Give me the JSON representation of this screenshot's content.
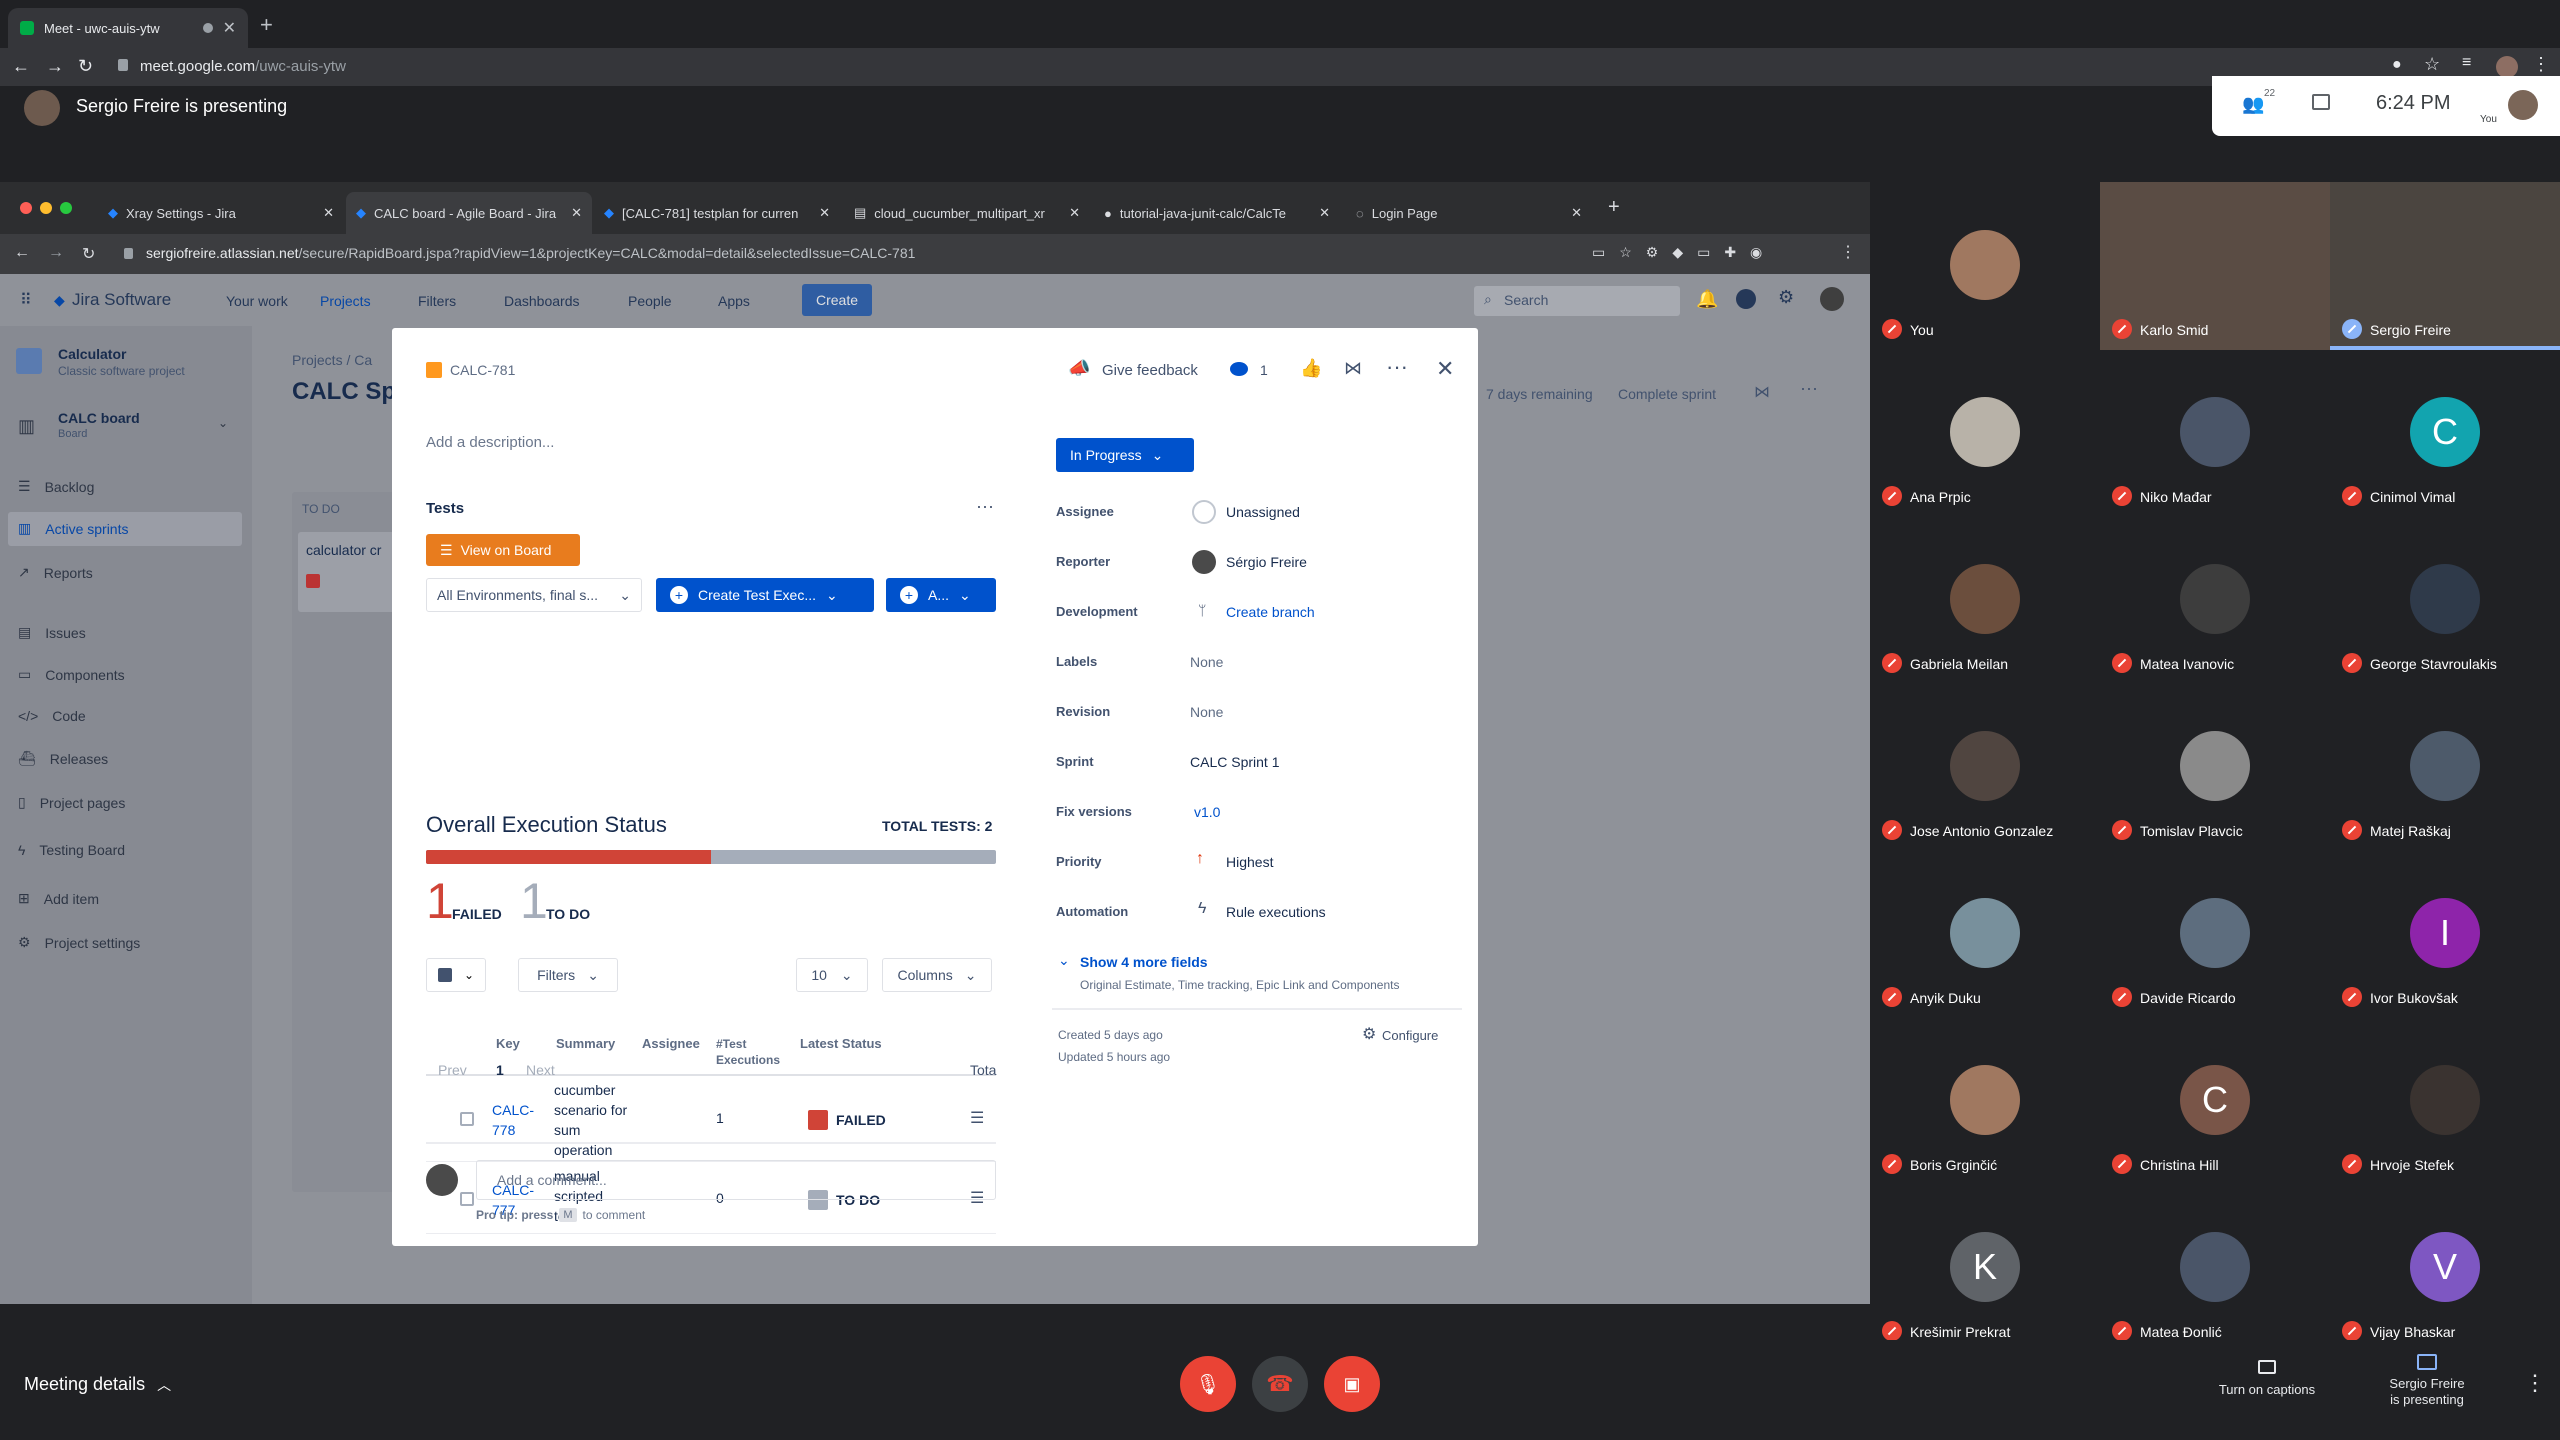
{
  "outer_tab": {
    "title": "Meet - uwc-auis-ytw"
  },
  "outer_url": {
    "domain": "meet.google.com",
    "path": "/uwc-auis-ytw"
  },
  "meet_top": {
    "presenting": "Sergio Freire is presenting",
    "participants_count": "22",
    "time": "6:24 PM",
    "you": "You"
  },
  "inner_tabs": [
    {
      "title": "Xray Settings - Jira"
    },
    {
      "title": "CALC board - Agile Board - Jira"
    },
    {
      "title": "[CALC-781] testplan for curren"
    },
    {
      "title": "cloud_cucumber_multipart_xr"
    },
    {
      "title": "tutorial-java-junit-calc/CalcTe"
    },
    {
      "title": "Login Page"
    }
  ],
  "inner_url": {
    "domain": "sergiofreire.atlassian.net",
    "path": "/secure/RapidBoard.jspa?rapidView=1&projectKey=CALC&modal=detail&selectedIssue=CALC-781"
  },
  "jira_nav": {
    "logo": "Jira Software",
    "your_work": "Your work",
    "projects": "Projects",
    "filters": "Filters",
    "dashboards": "Dashboards",
    "people": "People",
    "apps": "Apps",
    "create": "Create",
    "search_placeholder": "Search"
  },
  "sidebar": {
    "project_name": "Calculator",
    "project_type": "Classic software project",
    "board_name": "CALC board",
    "board_sub": "Board",
    "items": [
      {
        "label": "Backlog"
      },
      {
        "label": "Active sprints"
      },
      {
        "label": "Reports"
      },
      {
        "label": "Issues"
      },
      {
        "label": "Components"
      },
      {
        "label": "Code"
      },
      {
        "label": "Releases"
      },
      {
        "label": "Project pages"
      },
      {
        "label": "Testing Board"
      },
      {
        "label": "Add item"
      },
      {
        "label": "Project settings"
      }
    ]
  },
  "board": {
    "breadcrumb": "Projects  /  Ca",
    "title": "CALC Spr",
    "days_remaining": "7 days remaining",
    "complete_sprint": "Complete sprint",
    "col_todo": "TO DO",
    "card": "calculator cr"
  },
  "modal": {
    "issue_key": "CALC-781",
    "give_feedback": "Give feedback",
    "watchers": "1",
    "add_description": "Add a description...",
    "tests_heading": "Tests",
    "view_on_board": "View on Board",
    "env_select": "All Environments, final s...",
    "create_test_exec": "Create Test Exec...",
    "a_button": "A...",
    "overall_status": "Overall Execution Status",
    "total_tests": "TOTAL TESTS: 2",
    "failed_count": "1",
    "failed_label": "FAILED",
    "todo_count": "1",
    "todo_label": "TO DO",
    "filters": "Filters",
    "page_size": "10",
    "columns": "Columns",
    "table": {
      "headers": {
        "key": "Key",
        "summary": "Summary",
        "assignee": "Assignee",
        "executions": "#Test Executions",
        "status": "Latest Status"
      },
      "rows": [
        {
          "key": "CALC-778",
          "summary": "cucumber scenario for sum operation",
          "executions": "1",
          "status": "FAILED"
        },
        {
          "key": "CALC-777",
          "summary": "manual scripted test",
          "executions": "0",
          "status": "TO DO"
        }
      ]
    },
    "pager": {
      "prev": "Prev",
      "page": "1",
      "next": "Next",
      "total": "Tota"
    },
    "comment_placeholder": "Add a comment...",
    "pro_tip_prefix": "Pro tip: press",
    "pro_tip_key": "M",
    "pro_tip_suffix": "to comment",
    "status_button": "In Progress",
    "fields": {
      "assignee_label": "Assignee",
      "assignee": "Unassigned",
      "reporter_label": "Reporter",
      "reporter": "Sérgio Freire",
      "development_label": "Development",
      "development": "Create branch",
      "labels_label": "Labels",
      "labels": "None",
      "revision_label": "Revision",
      "revision": "None",
      "sprint_label": "Sprint",
      "sprint": "CALC Sprint 1",
      "fix_label": "Fix versions",
      "fix": "v1.0",
      "priority_label": "Priority",
      "priority": "Highest",
      "automation_label": "Automation",
      "automation": "Rule executions"
    },
    "show_more": "Show 4 more fields",
    "show_more_sub": "Original Estimate, Time tracking, Epic Link and Components",
    "created": "Created 5 days ago",
    "updated": "Updated 5 hours ago",
    "configure": "Configure"
  },
  "participants": [
    {
      "name": "You",
      "initial": ""
    },
    {
      "name": "Karlo Smid",
      "initial": ""
    },
    {
      "name": "Sergio Freire",
      "initial": ""
    },
    {
      "name": "Ana Prpic",
      "initial": ""
    },
    {
      "name": "Niko Mađar",
      "initial": ""
    },
    {
      "name": "Cinimol Vimal",
      "initial": "C"
    },
    {
      "name": "Gabriela Meilan",
      "initial": ""
    },
    {
      "name": "Matea Ivanovic",
      "initial": ""
    },
    {
      "name": "George Stavroulakis",
      "initial": ""
    },
    {
      "name": "Jose Antonio Gonzalez",
      "initial": ""
    },
    {
      "name": "Tomislav Plavcic",
      "initial": ""
    },
    {
      "name": "Matej Raškaj",
      "initial": ""
    },
    {
      "name": "Anyik Duku",
      "initial": ""
    },
    {
      "name": "Davide Ricardo",
      "initial": ""
    },
    {
      "name": "Ivor Bukovšak",
      "initial": "I"
    },
    {
      "name": "Boris Grginčić",
      "initial": ""
    },
    {
      "name": "Christina Hill",
      "initial": "C"
    },
    {
      "name": "Hrvoje Stefek",
      "initial": ""
    },
    {
      "name": "Krešimir Prekrat",
      "initial": "K"
    },
    {
      "name": "Matea Đonlić",
      "initial": ""
    },
    {
      "name": "Vijay Bhaskar",
      "initial": "V"
    }
  ],
  "bottom": {
    "meeting_details": "Meeting details",
    "captions": "Turn on captions",
    "presenting_line1": "Sergio Freire",
    "presenting_line2": "is presenting"
  },
  "colors": {
    "failed": "#d04437",
    "todo": "#a5adba",
    "jira_blue": "#0052cc",
    "meet_red": "#ea4335",
    "status_blue": "#0052cc"
  }
}
